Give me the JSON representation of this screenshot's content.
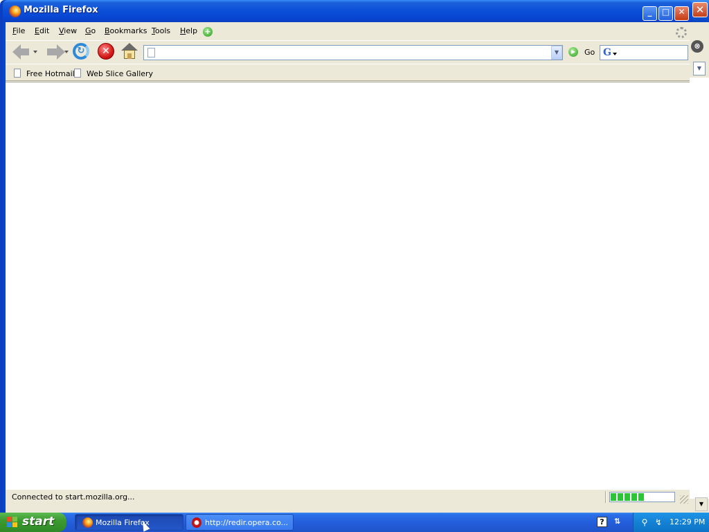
{
  "window": {
    "title": "Mozilla Firefox",
    "minimize": "_",
    "maximize": "□",
    "close": "✕"
  },
  "menubar": {
    "items": [
      {
        "label": "File",
        "accel": "F"
      },
      {
        "label": "Edit",
        "accel": "E"
      },
      {
        "label": "View",
        "accel": "V"
      },
      {
        "label": "Go",
        "accel": "G"
      },
      {
        "label": "Bookmarks",
        "accel": "B"
      },
      {
        "label": "Tools",
        "accel": "T"
      },
      {
        "label": "Help",
        "accel": "H"
      }
    ]
  },
  "navbar": {
    "url_value": "",
    "go_label": "Go",
    "search_value": ""
  },
  "bookmarks": [
    {
      "label": "Free Hotmail"
    },
    {
      "label": "Web Slice Gallery"
    }
  ],
  "status": {
    "text": "Connected to start.mozilla.org...",
    "progress": 0.55
  },
  "taskbar": {
    "start_label": "start",
    "buttons": [
      {
        "label": "Mozilla Firefox",
        "active": true
      },
      {
        "label": "http://redir.opera.co...",
        "active": false
      }
    ],
    "clock": "12:29 PM"
  },
  "colors": {
    "titlebar": "#0b4ed8",
    "taskbar": "#245edb",
    "start": "#3c9a31",
    "chrome": "#ece9d8",
    "progress": "#2ec43a"
  }
}
